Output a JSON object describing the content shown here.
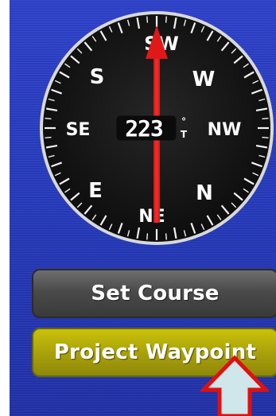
{
  "compass": {
    "heading_digits": "223",
    "heading_unit_top": "°",
    "heading_unit_bottom": "T",
    "directions": [
      "W",
      "NW",
      "N",
      "NE",
      "E",
      "SE",
      "S",
      "SW"
    ],
    "heading_degrees": 223,
    "colors": {
      "dial": "#121212",
      "bezel": "#f2f2f2",
      "needle": "#e01818"
    }
  },
  "buttons": {
    "set_course": "Set Course",
    "project_waypoint": "Project Waypoint"
  },
  "colors": {
    "background": "#2337b8",
    "set_course_button": "#4a4a4a",
    "project_waypoint_button": "#aaa20a",
    "annotation_arrow_fill": "#cfe6ea",
    "annotation_arrow_stroke": "#e01010"
  }
}
